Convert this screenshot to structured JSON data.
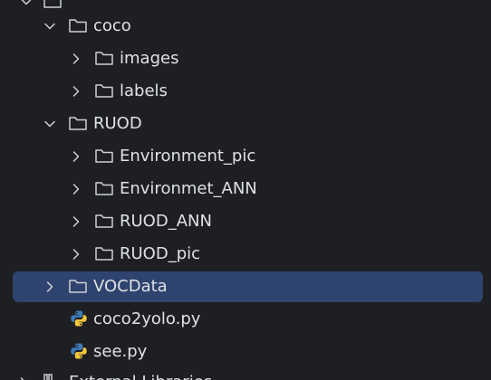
{
  "tree": {
    "top_partial_label": "",
    "items": [
      {
        "label": "coco",
        "type": "folder",
        "expanded": true
      },
      {
        "label": "images",
        "type": "folder",
        "expanded": false
      },
      {
        "label": "labels",
        "type": "folder",
        "expanded": false
      },
      {
        "label": "RUOD",
        "type": "folder",
        "expanded": true
      },
      {
        "label": "Environment_pic",
        "type": "folder",
        "expanded": false
      },
      {
        "label": "Environmet_ANN",
        "type": "folder",
        "expanded": false
      },
      {
        "label": "RUOD_ANN",
        "type": "folder",
        "expanded": false
      },
      {
        "label": "RUOD_pic",
        "type": "folder",
        "expanded": false
      },
      {
        "label": "VOCData",
        "type": "folder",
        "expanded": false,
        "selected": true
      },
      {
        "label": "coco2yolo.py",
        "type": "python-file"
      },
      {
        "label": "see.py",
        "type": "python-file"
      }
    ],
    "bottom_partial_label": "External Libraries"
  },
  "colors": {
    "background": "#1e1f22",
    "selection": "#2e436e",
    "text": "#dfe1e5",
    "icon": "#ced0d6",
    "python_blue": "#3d7ab6",
    "python_yellow": "#f7c83c"
  },
  "icons": {
    "chevron_down": "chevron-down-icon",
    "chevron_right": "chevron-right-icon",
    "folder": "folder-icon",
    "python": "python-file-icon"
  }
}
